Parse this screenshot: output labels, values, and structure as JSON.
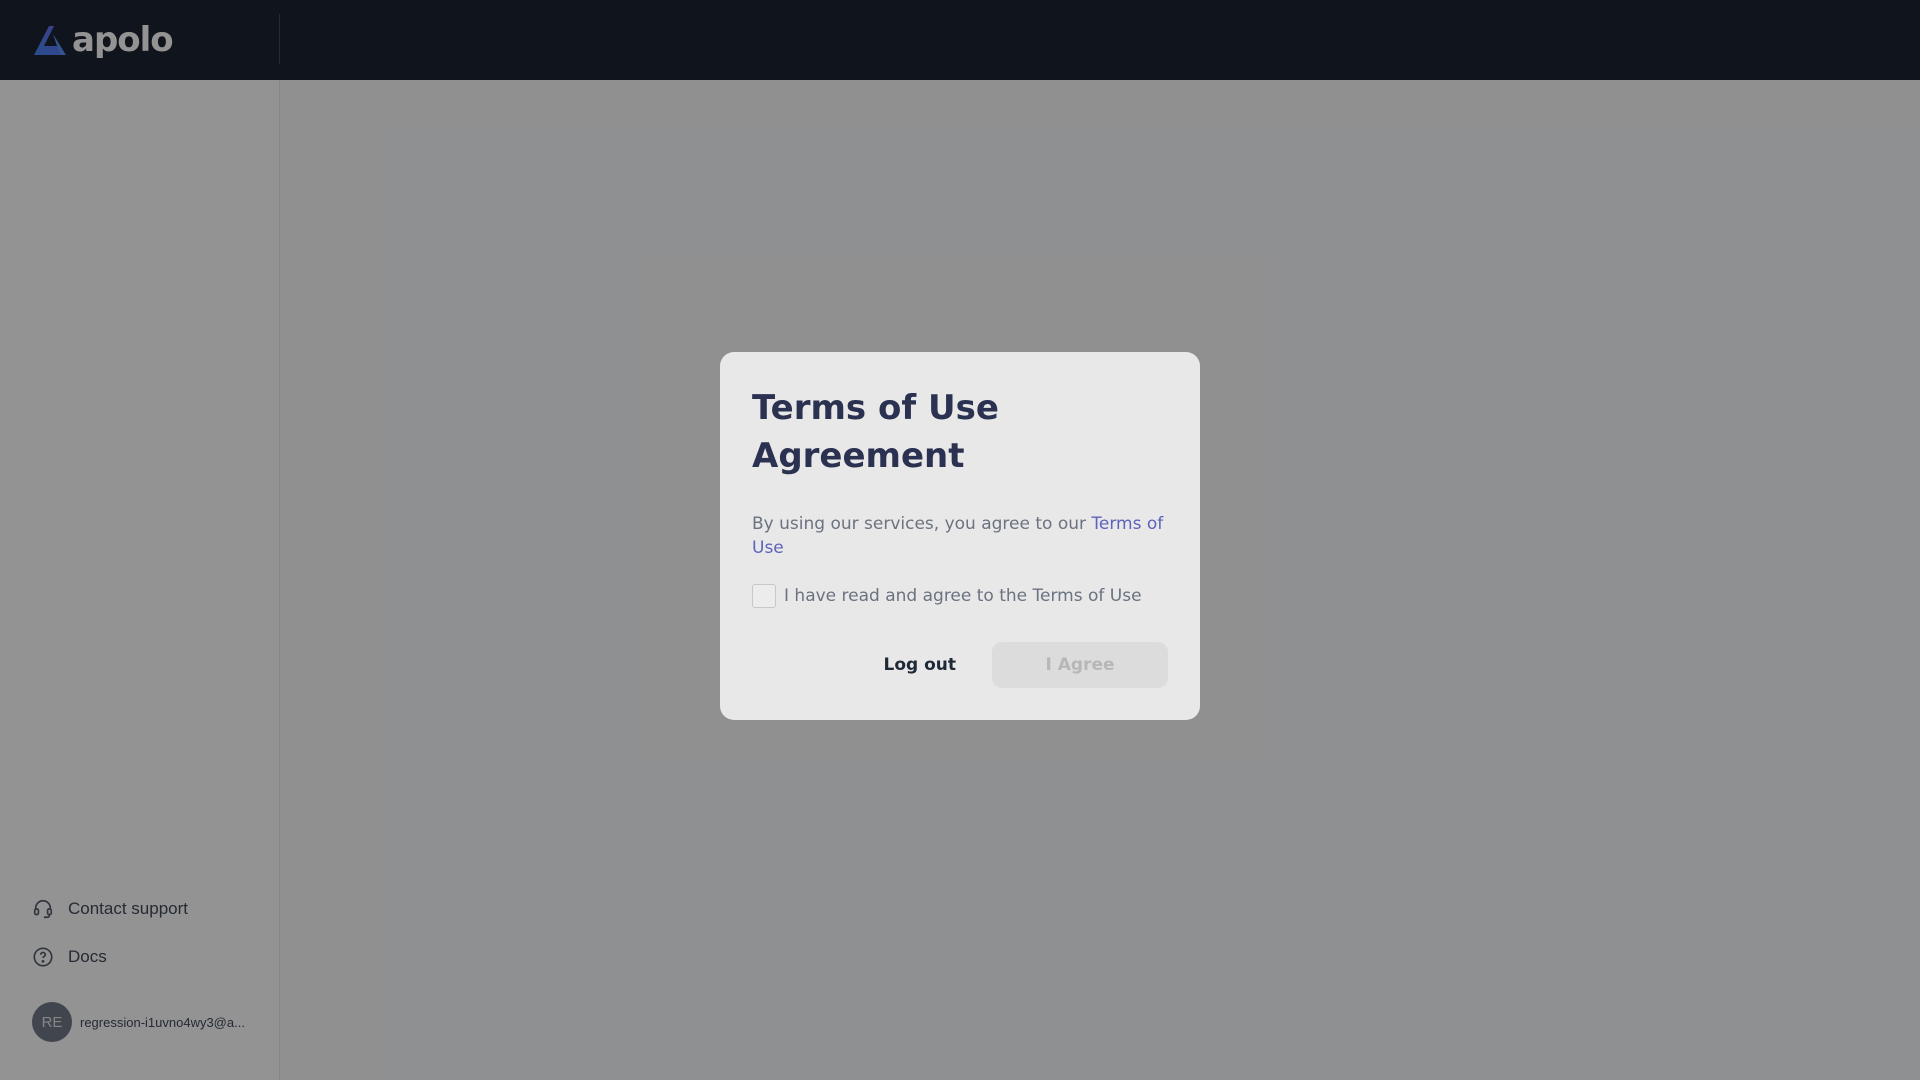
{
  "header": {
    "brand_name": "apolo",
    "logo_icon": "apolo-logo-icon"
  },
  "sidebar": {
    "links": [
      {
        "label": "Contact support",
        "icon": "headset-icon"
      },
      {
        "label": "Docs",
        "icon": "question-circle-icon"
      }
    ],
    "user": {
      "initials": "RE",
      "email": "regression-i1uvno4wy3@a..."
    }
  },
  "modal": {
    "title": "Terms of Use Agreement",
    "text_prefix": "By using our services, you agree to our ",
    "text_link": "Terms of Use",
    "checkbox_label": "I have read and agree to the Terms of Use",
    "checkbox_checked": false,
    "logout_label": "Log out",
    "agree_label": "I Agree",
    "agree_disabled": true
  },
  "colors": {
    "topbar_bg": "#111827",
    "title": "#2b3150",
    "link": "#5c63b8",
    "overlay": "rgba(15,15,15,0.45)"
  }
}
